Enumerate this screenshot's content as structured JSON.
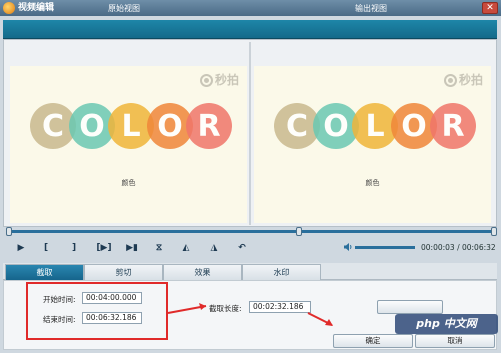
{
  "window": {
    "title": "视频编辑",
    "close": "✕"
  },
  "views": {
    "original_title": "原始视图",
    "output_title": "输出视图",
    "watermark_text": "秒拍",
    "color_letters": [
      "C",
      "O",
      "L",
      "O",
      "R"
    ],
    "caption": "颜色",
    "circle_colors": [
      "#c9b98e",
      "#6bc8b2",
      "#f0b53a",
      "#f0873a",
      "#f0766a"
    ]
  },
  "player": {
    "play": "▶",
    "mark_in": "[",
    "mark_out": "]",
    "play_segment": "[▶]",
    "step": "▶▮",
    "split": "⧖",
    "trim_left": "◭",
    "trim_right": "◮",
    "undo": "↶",
    "time": "00:00:03 / 00:06:32"
  },
  "tabs": [
    "截取",
    "剪切",
    "效果",
    "水印"
  ],
  "clip": {
    "start_label": "开始时间:",
    "start_value": "00:04:00.000",
    "end_label": "结束时间:",
    "end_value": "00:06:32.186",
    "length_label": "截取长度:",
    "length_value": "00:02:32.186"
  },
  "buttons": {
    "ok": "确定",
    "cancel": "取消"
  },
  "overlay": {
    "php": "php 中文网"
  },
  "colors": {
    "accent": "#16658c",
    "highlight": "#e02a2a"
  }
}
